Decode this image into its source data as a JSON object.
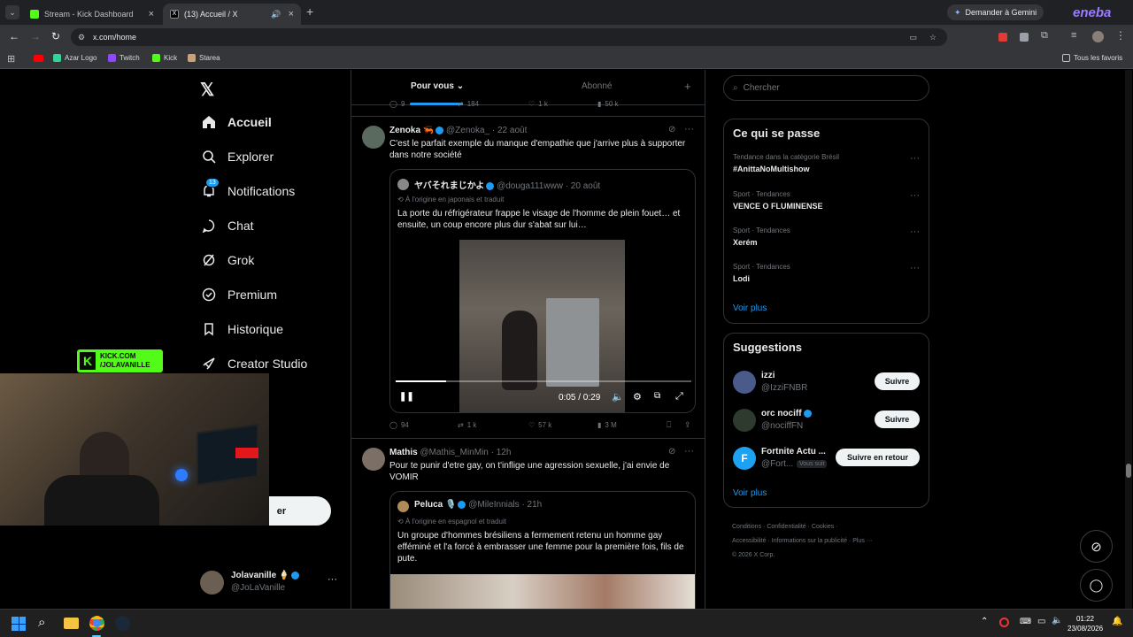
{
  "browser": {
    "tabs": [
      {
        "title": "Stream - Kick Dashboard",
        "active": false
      },
      {
        "title": "(13) Accueil / X",
        "active": true
      }
    ],
    "new_tab": "+",
    "url": "x.com/home",
    "gemini_button": "Demander à Gemini",
    "ext_logo": "eneba",
    "bookmarks": [
      "Azar Logo",
      "Twitch",
      "Kick",
      "Starea"
    ],
    "all_favorites": "Tous les favoris"
  },
  "sidebar": {
    "items": [
      {
        "label": "Accueil",
        "icon": "home-icon"
      },
      {
        "label": "Explorer",
        "icon": "search-icon"
      },
      {
        "label": "Notifications",
        "icon": "bell-icon",
        "badge": "13"
      },
      {
        "label": "Chat",
        "icon": "chat-icon"
      },
      {
        "label": "Grok",
        "icon": "grok-icon"
      },
      {
        "label": "Premium",
        "icon": "premium-icon"
      },
      {
        "label": "Historique",
        "icon": "bookmark-icon"
      },
      {
        "label": "Creator Studio",
        "icon": "rocket-icon"
      }
    ],
    "post_button": "er",
    "profile_name": "Jolavanille 🍦",
    "profile_handle": "@JoLaVanille",
    "more": "···"
  },
  "overlay": {
    "kick_line1": "KICK.COM",
    "kick_line2": "/JOLAVANILLE"
  },
  "feed": {
    "tabs": [
      "Pour vous",
      "Abonné"
    ],
    "top_stats": {
      "replies": "9",
      "reposts": "184",
      "likes": "1 k",
      "views": "50 k"
    },
    "post1": {
      "name": "Zenoka 🦐",
      "handle": "@Zenoka_",
      "date": "· 22 août",
      "text": "C'est le parfait exemple du manque d'empathie que j'arrive plus à supporter dans notre société",
      "quote": {
        "name": "ヤバそれまじかよ",
        "handle": "@douga111www",
        "date": "· 20 août",
        "translated": "À l'origine en japonais et traduit",
        "text": "La porte du réfrigérateur frappe le visage de l'homme de plein fouet… et ensuite, un coup encore plus dur s'abat sur lui…"
      },
      "video_time": "0:05 / 0:29",
      "video_progress": 0.17,
      "stats": {
        "replies": "94",
        "reposts": "1 k",
        "likes": "57 k",
        "views": "3 M"
      }
    },
    "post2": {
      "name": "Mathis",
      "handle": "@Mathis_MinMin",
      "date": "· 12h",
      "text": "Pour te punir d'etre gay, on t'inflige une agression sexuelle, j'ai envie de VOMIR",
      "quote": {
        "name": "Peluca 🎙️",
        "handle": "@MileInnials",
        "date": "· 21h",
        "translated": "À l'origine en espagnol et traduit",
        "text": "Un groupe d'hommes brésiliens a fermement retenu un homme gay efféminé et l'a forcé à embrasser une femme pour la première fois, fils de pute."
      }
    }
  },
  "right": {
    "search_placeholder": "Chercher",
    "trends_title": "Ce qui se passe",
    "trends": [
      {
        "category": "Tendance dans la catégorie Brésil",
        "name": "#AnittaNoMultishow"
      },
      {
        "category": "Sport · Tendances",
        "name": "VENCE O FLUMINENSE"
      },
      {
        "category": "Sport · Tendances",
        "name": "Xerém"
      },
      {
        "category": "Sport · Tendances",
        "name": "Lodi"
      }
    ],
    "see_more": "Voir plus",
    "suggestions_title": "Suggestions",
    "suggestions": [
      {
        "name": "izzi",
        "handle": "@IzziFNBR",
        "button": "Suivre",
        "follows_you": ""
      },
      {
        "name": "orc nociff",
        "handle": "@nociffFN",
        "button": "Suivre",
        "follows_you": ""
      },
      {
        "name": "Fortnite Actu ...",
        "handle": "@Fort...",
        "button": "Suivre en retour",
        "follows_you": "Vous suit"
      }
    ],
    "footer_line1": [
      "Conditions",
      "Confidentialité",
      "Cookies"
    ],
    "footer_line2": [
      "Accessibilité",
      "Informations sur la publicité",
      "Plus ···"
    ],
    "copyright": "© 2026 X Corp."
  },
  "taskbar": {
    "time": "01:22",
    "date": "23/08/2026"
  },
  "colors": {
    "accent": "#1d9bf0",
    "kick_green": "#53fc18"
  }
}
